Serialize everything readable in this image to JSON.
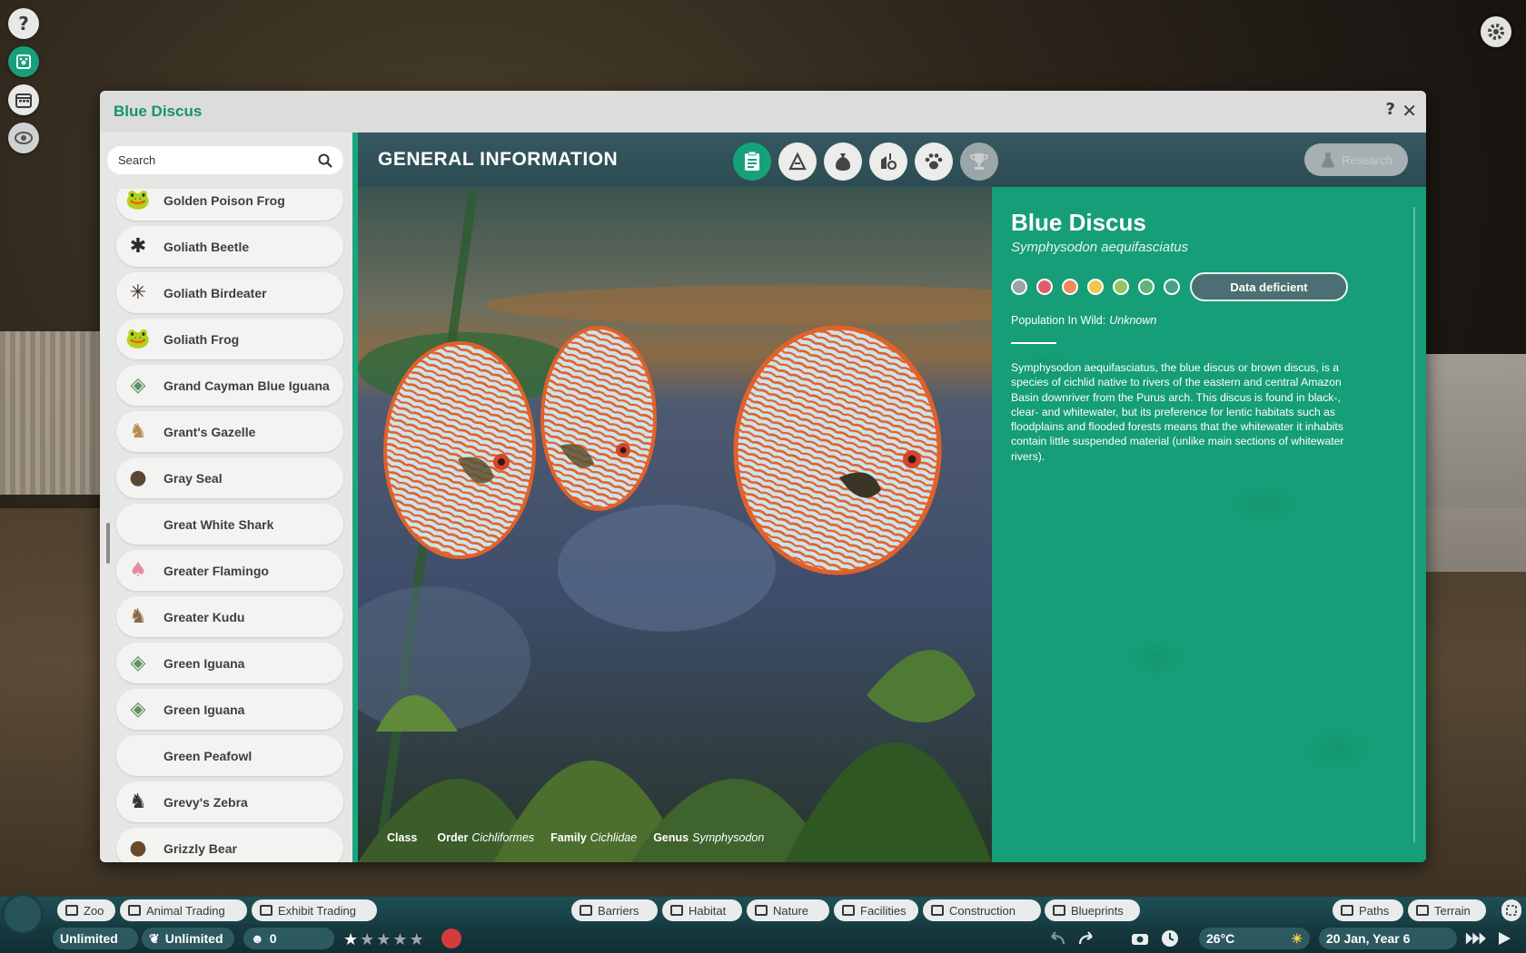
{
  "side_toolbar": {
    "help_glyph": "?",
    "items": [
      "help-icon",
      "animal-codex-icon",
      "calendar-icon",
      "camera-view-icon"
    ]
  },
  "window": {
    "title": "Blue Discus",
    "help_glyph": "?",
    "close_glyph": "✕"
  },
  "search": {
    "placeholder": "Search"
  },
  "animal_list": [
    {
      "name": "Golden Poison Frog",
      "icon": "frog-icon"
    },
    {
      "name": "Goliath Beetle",
      "icon": "beetle-icon"
    },
    {
      "name": "Goliath Birdeater",
      "icon": "spider-icon"
    },
    {
      "name": "Goliath Frog",
      "icon": "frog-icon"
    },
    {
      "name": "Grand Cayman Blue Iguana",
      "icon": "iguana-icon"
    },
    {
      "name": "Grant's Gazelle",
      "icon": "gazelle-icon"
    },
    {
      "name": "Gray Seal",
      "icon": "seal-icon"
    },
    {
      "name": "Great White Shark",
      "icon": ""
    },
    {
      "name": "Greater Flamingo",
      "icon": "flamingo-icon"
    },
    {
      "name": "Greater Kudu",
      "icon": "kudu-icon"
    },
    {
      "name": "Green Iguana",
      "icon": "iguana-icon"
    },
    {
      "name": "Green Iguana",
      "icon": "iguana-icon"
    },
    {
      "name": "Green Peafowl",
      "icon": ""
    },
    {
      "name": "Grevy's Zebra",
      "icon": "zebra-icon"
    },
    {
      "name": "Grizzly Bear",
      "icon": "bear-icon"
    }
  ],
  "content": {
    "section_title": "GENERAL INFORMATION",
    "tabs": [
      {
        "name": "general-info",
        "icon": "clipboard-icon",
        "active": true
      },
      {
        "name": "habitat",
        "icon": "habitat-icon",
        "active": false
      },
      {
        "name": "diet",
        "icon": "food-sack-icon",
        "active": false
      },
      {
        "name": "enrichment",
        "icon": "enrichment-icon",
        "active": false
      },
      {
        "name": "behaviour",
        "icon": "paw-icon",
        "active": false
      },
      {
        "name": "achievements",
        "icon": "trophy-icon",
        "active": false,
        "disabled": true
      }
    ],
    "research_label": "Research"
  },
  "taxonomy": {
    "class_label": "Class",
    "class_value": "",
    "order_label": "Order",
    "order_value": "Cichliformes",
    "family_label": "Family",
    "family_value": "Cichlidae",
    "genus_label": "Genus",
    "genus_value": "Symphysodon"
  },
  "info": {
    "name": "Blue Discus",
    "scientific_name": "Symphysodon aequifasciatus",
    "status_colors": [
      "#9aa4a6",
      "#e15b6e",
      "#f08a58",
      "#f0c64f",
      "#93c463",
      "#5fb27a",
      "#4aa084"
    ],
    "status_label": "Data deficient",
    "population_label": "Population In Wild:",
    "population_value": "Unknown",
    "description": "Symphysodon aequifasciatus, the blue discus or brown discus, is a species of cichlid native to rivers of the eastern and central Amazon Basin downriver from the Purus arch. This discus is found in black-, clear- and whitewater, but its preference for lentic habitats such as floodplains and flooded forests means that the whitewater it inhabits contain little suspended material (unlike main sections of whitewater rivers)."
  },
  "bottom_bar": {
    "left_tabs": [
      {
        "label": "Zoo",
        "icon": "zoo-icon"
      },
      {
        "label": "Animal Trading",
        "icon": "paw-icon"
      },
      {
        "label": "Exhibit Trading",
        "icon": "bug-icon"
      }
    ],
    "build_tabs": [
      {
        "label": "Barriers",
        "icon": "barrier-icon"
      },
      {
        "label": "Habitat",
        "icon": "habitat-icon"
      },
      {
        "label": "Nature",
        "icon": "tree-icon"
      },
      {
        "label": "Facilities",
        "icon": "building-icon"
      },
      {
        "label": "Construction",
        "icon": "construction-icon"
      },
      {
        "label": "Blueprints",
        "icon": "blueprint-icon"
      }
    ],
    "right_tabs": [
      {
        "label": "Paths",
        "icon": "path-icon"
      },
      {
        "label": "Terrain",
        "icon": "terrain-icon"
      }
    ],
    "money": "Unlimited",
    "research_points": "Unlimited",
    "guests": "0",
    "rating_stars": 1,
    "rating_max": 5,
    "temperature": "26°C",
    "date": "20 Jan, Year 6"
  }
}
